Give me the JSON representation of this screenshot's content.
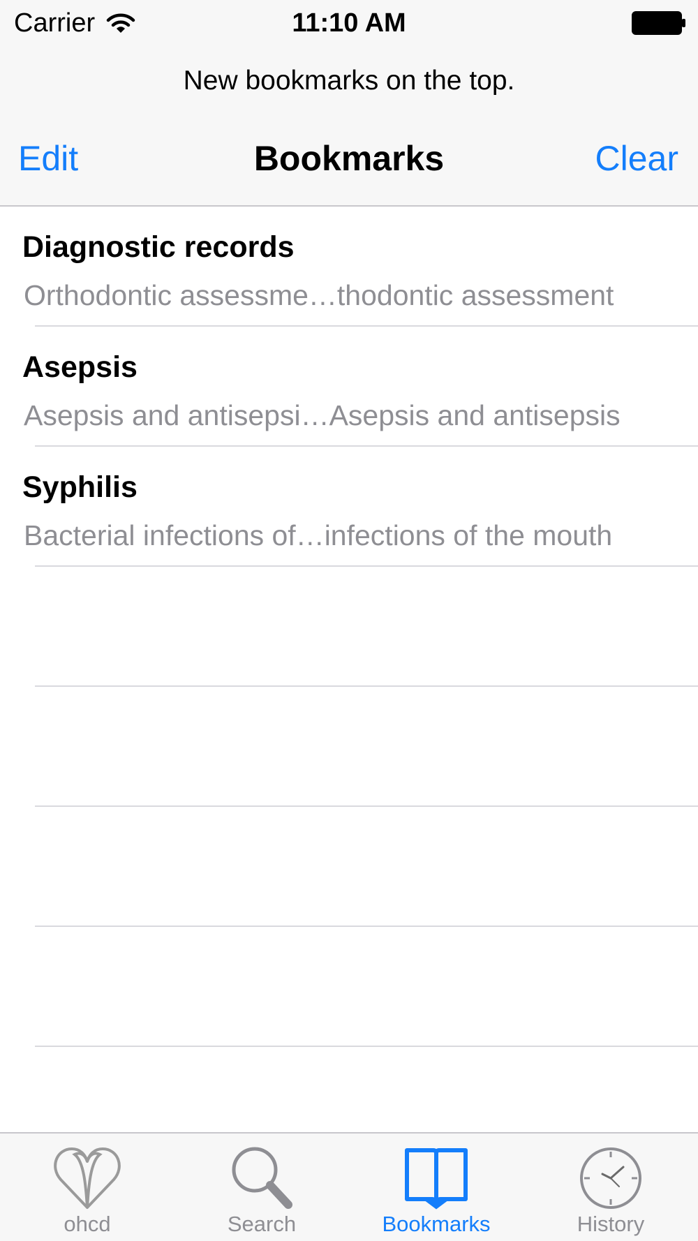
{
  "status_bar": {
    "carrier": "Carrier",
    "time": "11:10 AM"
  },
  "prompt": "New bookmarks on the top.",
  "nav": {
    "left_button": "Edit",
    "title": "Bookmarks",
    "right_button": "Clear"
  },
  "bookmarks": [
    {
      "title": "Diagnostic records",
      "subtitle": "Orthodontic assessme…thodontic assessment"
    },
    {
      "title": "Asepsis",
      "subtitle": "Asepsis and antisepsi…Asepsis and antisepsis"
    },
    {
      "title": "Syphilis",
      "subtitle": "Bacterial infections of…infections of the mouth"
    }
  ],
  "tabs": [
    {
      "label": "ohcd",
      "icon": "heart-icon",
      "active": false
    },
    {
      "label": "Search",
      "icon": "search-icon",
      "active": false
    },
    {
      "label": "Bookmarks",
      "icon": "book-icon",
      "active": true
    },
    {
      "label": "History",
      "icon": "clock-icon",
      "active": false
    }
  ],
  "colors": {
    "accent": "#147efb",
    "inactive": "#8e8e93",
    "subtitle": "#8e8e93",
    "separator": "#d9d9de",
    "bar_background": "#f7f7f7"
  }
}
